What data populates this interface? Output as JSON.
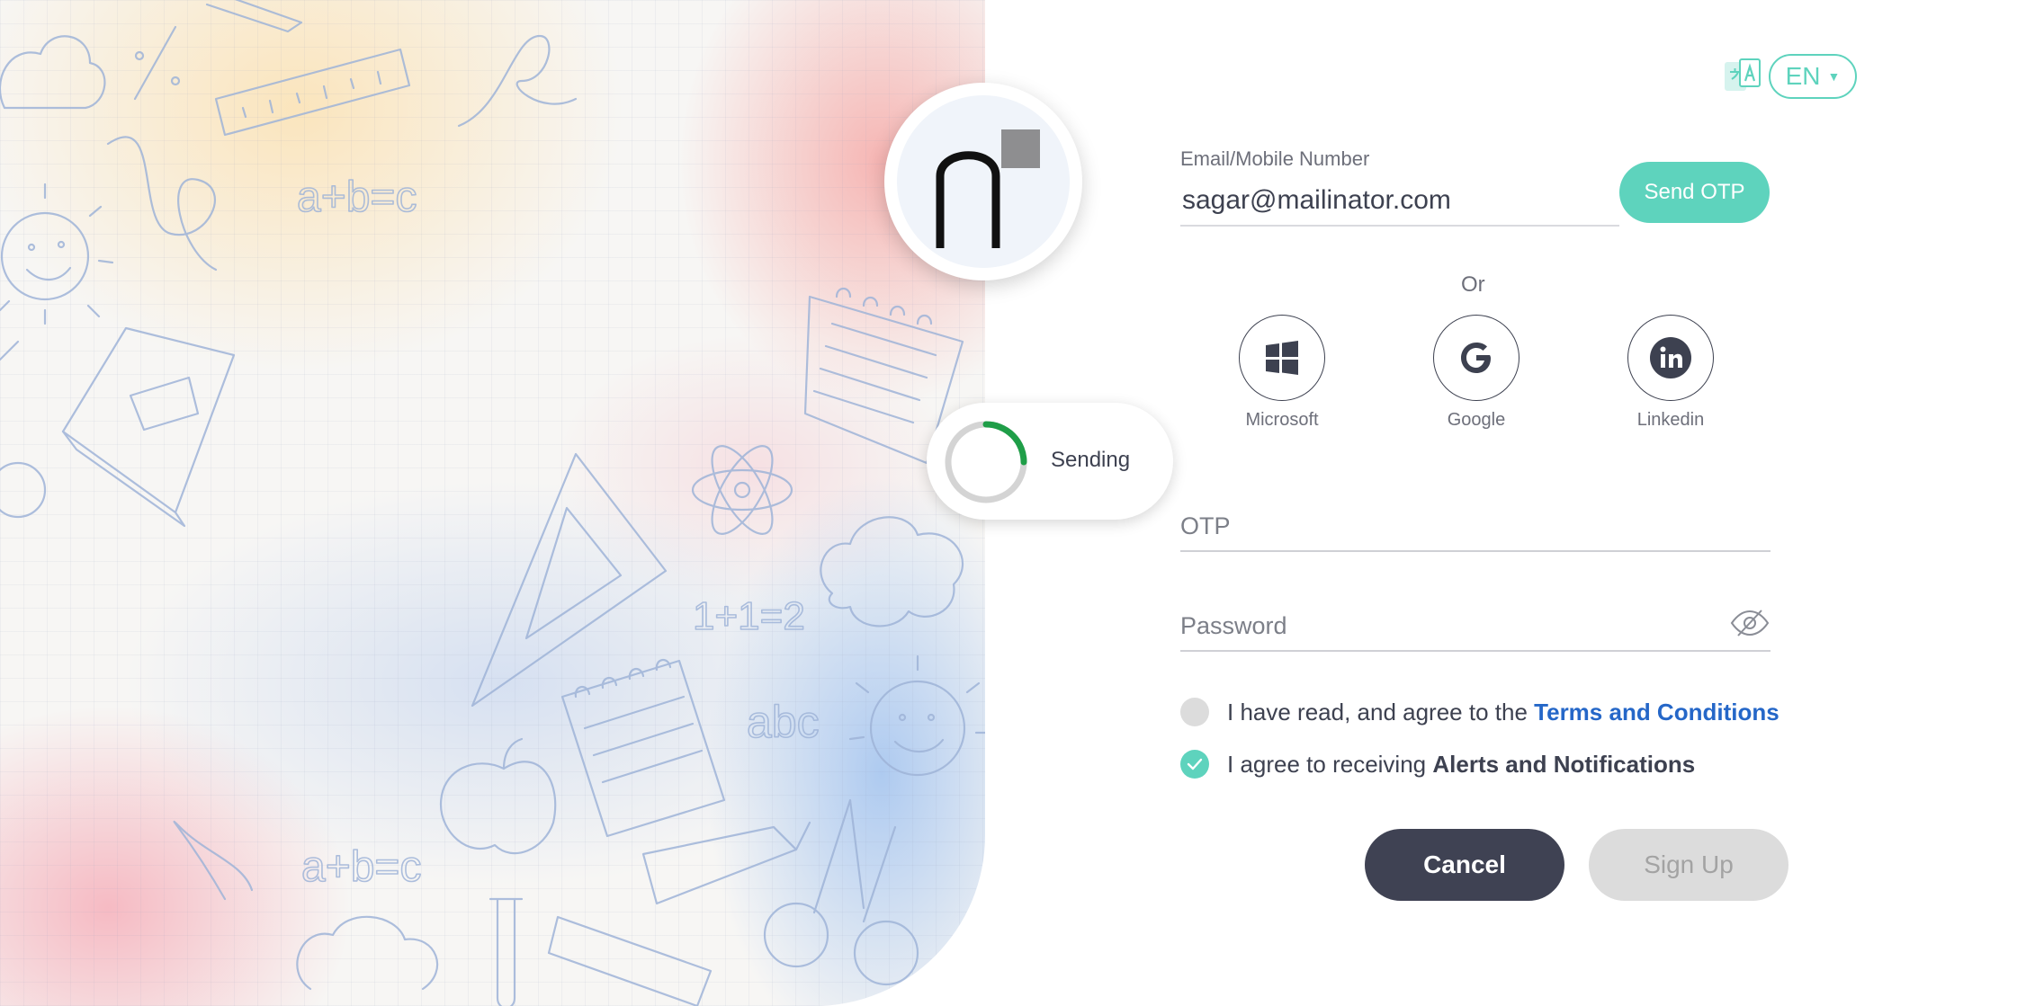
{
  "language": {
    "code": "EN",
    "icon": "translate-icon"
  },
  "brand": {
    "logo": "n-logo"
  },
  "toast": {
    "text": "Sending",
    "icon": "spinner-icon"
  },
  "form": {
    "email_label": "Email/Mobile Number",
    "email_value": "sagar@mailinator.com",
    "send_otp_label": "Send OTP",
    "or_text": "Or",
    "social": [
      {
        "label": "Microsoft",
        "icon": "windows-icon"
      },
      {
        "label": "Google",
        "icon": "google-icon"
      },
      {
        "label": "Linkedin",
        "icon": "linkedin-icon"
      }
    ],
    "otp_placeholder": "OTP",
    "password_placeholder": "Password",
    "terms_prefix": "I have read, and agree to the",
    "terms_link": "Terms and Conditions",
    "terms_checked": false,
    "alerts_prefix": "I agree to receiving",
    "alerts_bold": "Alerts and Notifications",
    "alerts_checked": true,
    "cancel_label": "Cancel",
    "signup_label": "Sign Up"
  },
  "colors": {
    "accent": "#5ed3bd",
    "dark_button": "#3f4253",
    "link": "#2567c8",
    "disabled": "#dcdcdc"
  }
}
